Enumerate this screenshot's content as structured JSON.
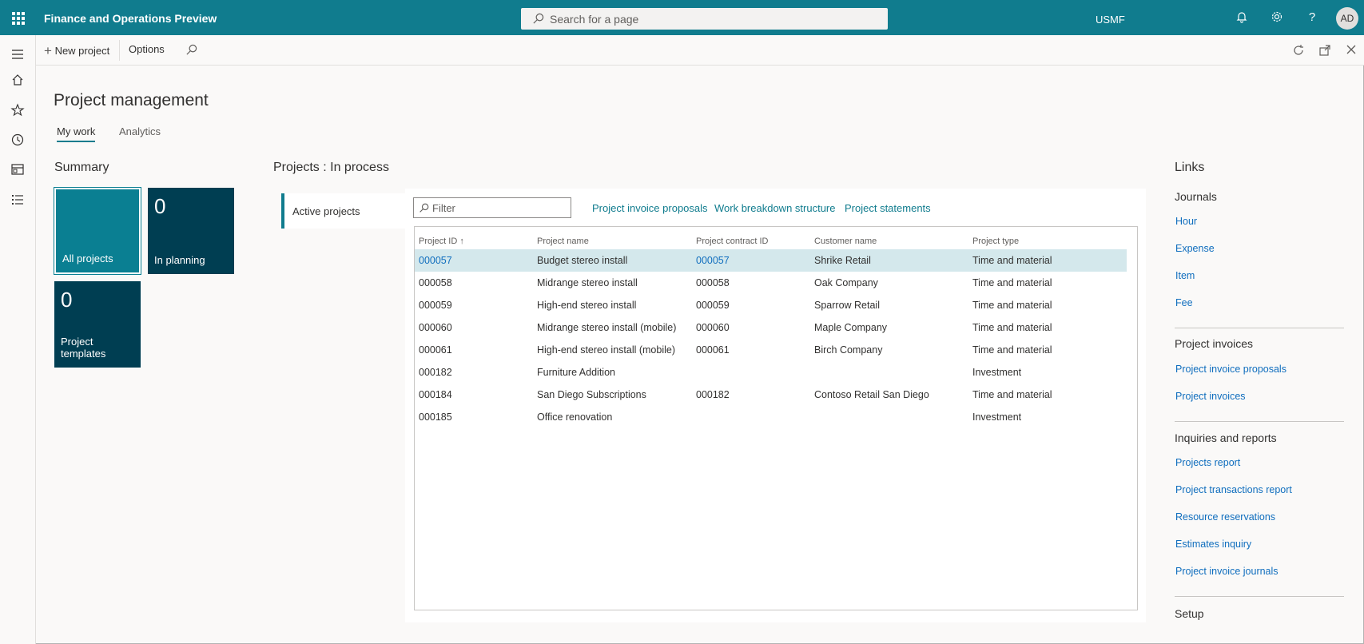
{
  "app": {
    "title": "Finance and Operations Preview",
    "search_placeholder": "Search for a page",
    "company": "USMF",
    "user_initials": "AD",
    "accent_color": "#107c8e"
  },
  "actionbar": {
    "new_project": "New project",
    "options": "Options"
  },
  "page": {
    "title": "Project management",
    "tabs": [
      {
        "label": "My work",
        "active": true
      },
      {
        "label": "Analytics",
        "active": false
      }
    ]
  },
  "summary": {
    "title": "Summary",
    "tiles": [
      {
        "label": "All projects",
        "count": "",
        "color": "#0a7f92"
      },
      {
        "label": "In planning",
        "count": "0",
        "color": "#003e52"
      },
      {
        "label": "Project templates",
        "count": "0",
        "color": "#003e52"
      }
    ]
  },
  "projects": {
    "title": "Projects : In process",
    "vtab": "Active projects",
    "filter_placeholder": "Filter",
    "links": [
      "Project invoice proposals",
      "Work breakdown structure",
      "Project statements"
    ],
    "columns": [
      "Project ID",
      "Project name",
      "Project contract ID",
      "Customer name",
      "Project type"
    ],
    "rows": [
      {
        "id": "000057",
        "name": "Budget stereo install",
        "contract": "000057",
        "customer": "Shrike Retail",
        "type": "Time and material"
      },
      {
        "id": "000058",
        "name": "Midrange stereo install",
        "contract": "000058",
        "customer": "Oak Company",
        "type": "Time and material"
      },
      {
        "id": "000059",
        "name": "High-end stereo install",
        "contract": "000059",
        "customer": "Sparrow Retail",
        "type": "Time and material"
      },
      {
        "id": "000060",
        "name": "Midrange stereo install (mobile)",
        "contract": "000060",
        "customer": "Maple Company",
        "type": "Time and material"
      },
      {
        "id": "000061",
        "name": "High-end stereo install (mobile)",
        "contract": "000061",
        "customer": "Birch Company",
        "type": "Time and material"
      },
      {
        "id": "000182",
        "name": "Furniture Addition",
        "contract": "",
        "customer": "",
        "type": "Investment"
      },
      {
        "id": "000184",
        "name": "San Diego Subscriptions",
        "contract": "000182",
        "customer": "Contoso Retail San Diego",
        "type": "Time and material"
      },
      {
        "id": "000185",
        "name": "Office renovation",
        "contract": "",
        "customer": "",
        "type": "Investment"
      }
    ]
  },
  "links": {
    "title": "Links",
    "groups": [
      {
        "title": "Journals",
        "items": [
          "Hour",
          "Expense",
          "Item",
          "Fee"
        ]
      },
      {
        "title": "Project invoices",
        "items": [
          "Project invoice proposals",
          "Project invoices"
        ]
      },
      {
        "title": "Inquiries and reports",
        "items": [
          "Projects report",
          "Project transactions report",
          "Resource reservations",
          "Estimates inquiry",
          "Project invoice journals"
        ]
      },
      {
        "title": "Setup",
        "items": []
      }
    ]
  }
}
